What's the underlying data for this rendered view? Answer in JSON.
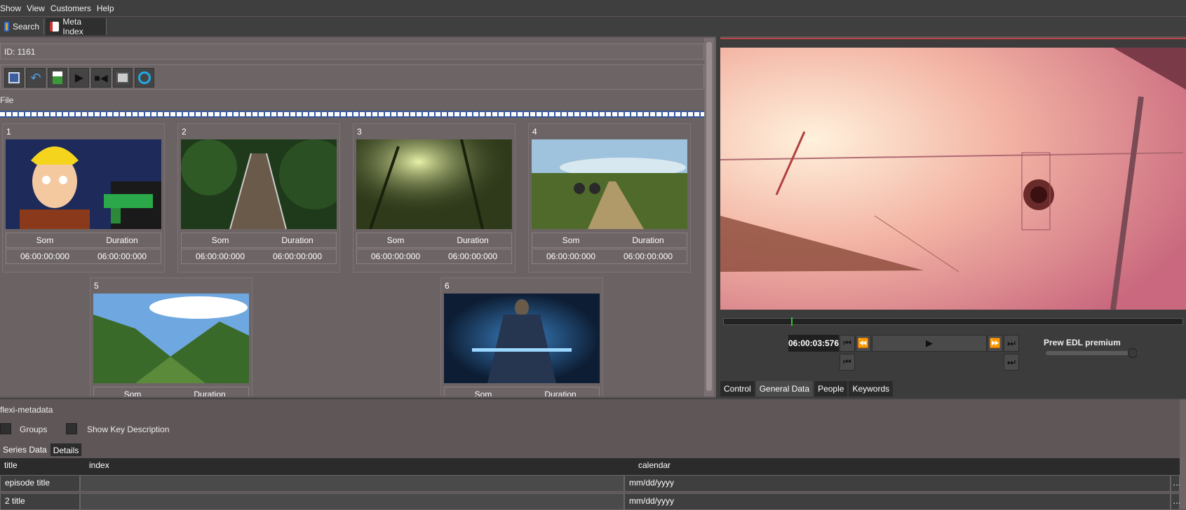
{
  "menu": [
    "Show",
    "View",
    "Customers",
    "Help"
  ],
  "app_tabs": [
    {
      "label": "Search"
    },
    {
      "label": "Meta Index"
    }
  ],
  "record": {
    "id_label": "ID: 1161"
  },
  "toolbar": {
    "buttons": [
      "save-icon",
      "undo-icon",
      "image-icon",
      "play-icon",
      "camera-icon",
      "screen-icon",
      "circle-icon"
    ]
  },
  "file_label": "File",
  "clips": [
    {
      "num": "1",
      "som_label": "Som",
      "dur_label": "Duration",
      "som": "06:00:00:000",
      "duration": "06:00:00:000",
      "image": "cartoon-character-with-gun"
    },
    {
      "num": "2",
      "som_label": "Som",
      "dur_label": "Duration",
      "som": "06:00:00:000",
      "duration": "06:00:00:000",
      "image": "suspension-bridge-forest"
    },
    {
      "num": "3",
      "som_label": "Som",
      "dur_label": "Duration",
      "som": "06:00:00:000",
      "duration": "06:00:00:000",
      "image": "misty-green-forest"
    },
    {
      "num": "4",
      "som_label": "Som",
      "dur_label": "Duration",
      "som": "06:00:00:000",
      "duration": "06:00:00:000",
      "image": "cyclists-coastal-trail"
    },
    {
      "num": "5",
      "som_label": "Som",
      "dur_label": "Duration",
      "som": "",
      "duration": "",
      "image": "mountain-valley"
    },
    {
      "num": "6",
      "som_label": "Som",
      "dur_label": "Duration",
      "som": "",
      "duration": "",
      "image": "jedi-with-lightsaber"
    }
  ],
  "player": {
    "timecode": "06:00:03:576",
    "edl_label": "Prew EDL premium",
    "tabs": [
      "Control",
      "General Data",
      "People",
      "Keywords"
    ],
    "active_tab": "General Data",
    "playhead_fraction": 0.146,
    "edl_level": 0.94
  },
  "metadata": {
    "title": "flexi-metadata",
    "groups_label": "Groups",
    "show_key_label": "Show Key Description",
    "subtabs": [
      "Series Data",
      "Details"
    ],
    "columns": [
      "title",
      "index",
      "calendar"
    ],
    "rows": [
      {
        "title": "episode title",
        "index": "",
        "calendar": "mm/dd/yyyy"
      },
      {
        "title": "2 title",
        "index": "",
        "calendar": "mm/dd/yyyy"
      }
    ]
  },
  "colors": {
    "accent_border": "#bb4444",
    "timeline_mark": "#22cc22",
    "filmstrip_blue": "#3a5a9a"
  }
}
